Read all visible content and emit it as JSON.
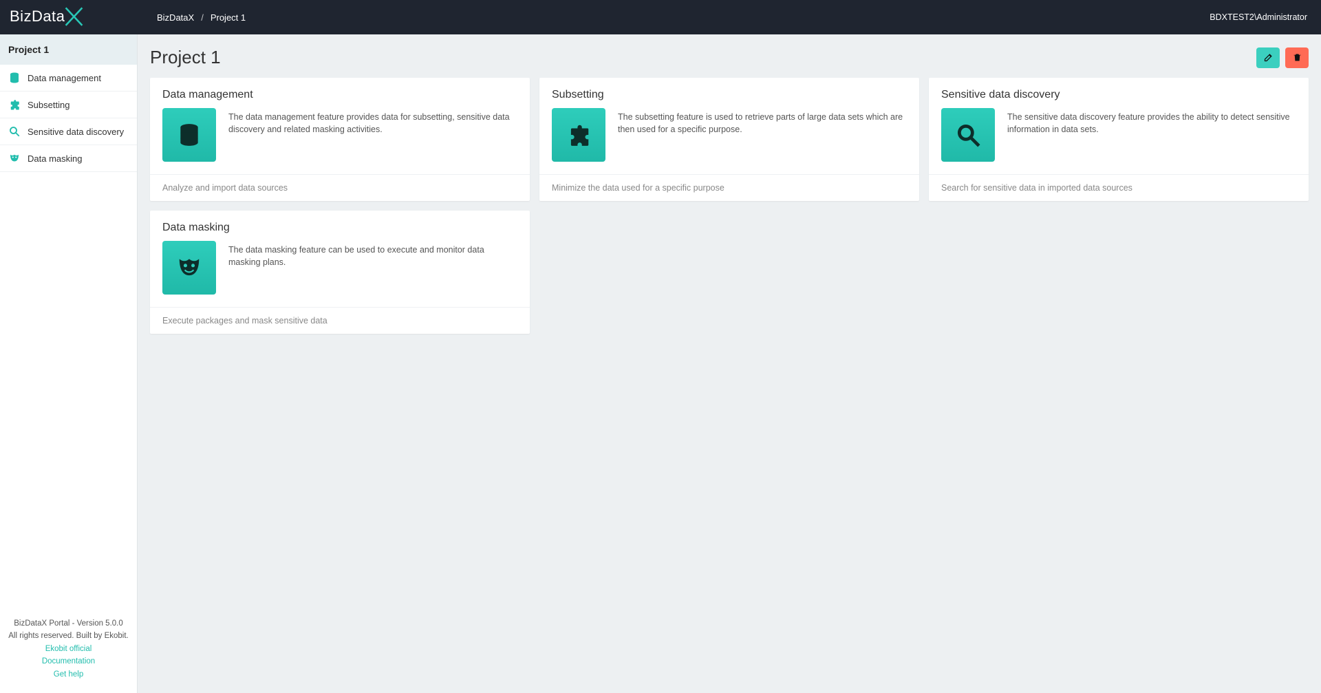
{
  "brand": "BizDataX",
  "breadcrumb": {
    "root": "BizDataX",
    "current": "Project 1"
  },
  "user": "BDXTEST2\\Administrator",
  "sidebar": {
    "title": "Project 1",
    "items": [
      {
        "key": "data-management",
        "label": "Data management"
      },
      {
        "key": "subsetting",
        "label": "Subsetting"
      },
      {
        "key": "sensitive-data-discovery",
        "label": "Sensitive data discovery"
      },
      {
        "key": "data-masking",
        "label": "Data masking"
      }
    ],
    "footer": {
      "version": "BizDataX Portal - Version 5.0.0",
      "copyright": "All rights reserved. Built by Ekobit.",
      "links": {
        "official": "Ekobit official",
        "docs": "Documentation",
        "help": "Get help"
      }
    }
  },
  "page": {
    "title": "Project 1"
  },
  "cards": {
    "data_management": {
      "title": "Data management",
      "desc": "The data management feature provides data for subsetting, sensitive data discovery and related masking activities.",
      "foot": "Analyze and import data sources"
    },
    "subsetting": {
      "title": "Subsetting",
      "desc": "The subsetting feature is used to retrieve parts of large data sets which are then used for a specific purpose.",
      "foot": "Minimize the data used for a specific purpose"
    },
    "discovery": {
      "title": "Sensitive data discovery",
      "desc": "The sensitive data discovery feature provides the ability to detect sensitive information in data sets.",
      "foot": "Search for sensitive data in imported data sources"
    },
    "masking": {
      "title": "Data masking",
      "desc": "The data masking feature can be used to execute and monitor data masking plans.",
      "foot": "Execute packages and mask sensitive data"
    }
  }
}
